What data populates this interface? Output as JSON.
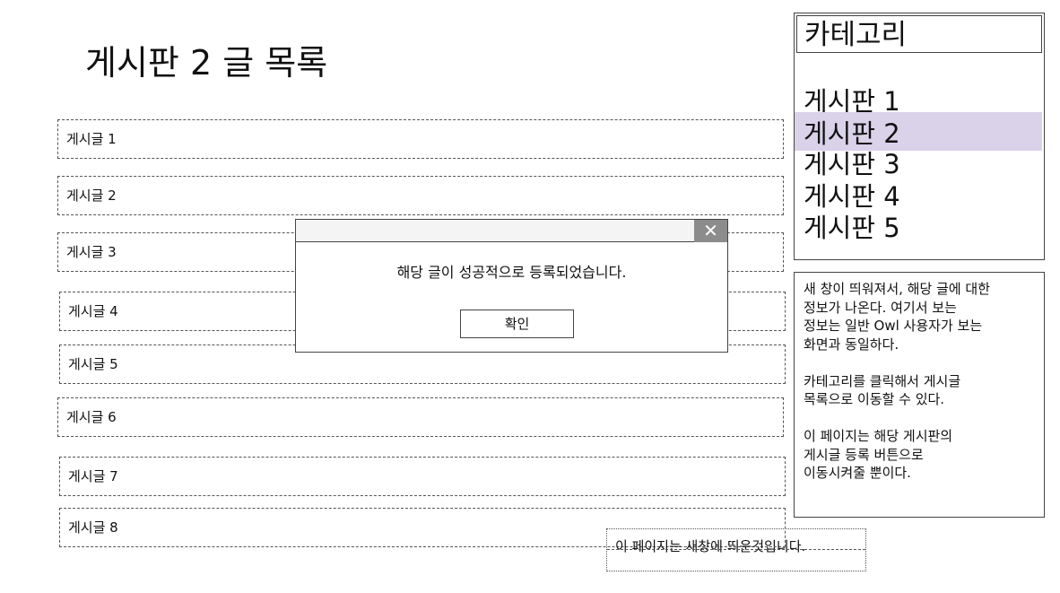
{
  "page": {
    "title": "게시판 2 글 목록"
  },
  "posts": [
    "게시글 1",
    "게시글 2",
    "게시글 3",
    "게시글 4",
    "게시글 5",
    "게시글 6",
    "게시글 7",
    "게시글 8"
  ],
  "category": {
    "header": "카테고리",
    "items": [
      "게시판 1",
      "게시판 2",
      "게시판 3",
      "게시판 4",
      "게시판 5"
    ],
    "selected_index": 1,
    "selected_color": "#d9d2e9"
  },
  "notes": [
    "새 창이 띄워져서, 해당 글에 대한\n정보가 나온다. 여기서 보는\n정보는 일반 Owl 사용자가 보는\n화면과 동일하다.",
    "카테고리를 클릭해서 게시글\n목록으로 이동할 수 있다.",
    "이 페이지는 해당 게시판의\n게시글 등록 버튼으로\n이동시켜줄 뿐이다."
  ],
  "dialog": {
    "close_glyph": "✕",
    "message": "해당 글이 성공적으로 등록되었습니다.",
    "ok_label": "확인",
    "close_button_color": "#8c8c8c"
  },
  "footer": {
    "note": "이 페이지는 새창에 띄운것입니다."
  }
}
